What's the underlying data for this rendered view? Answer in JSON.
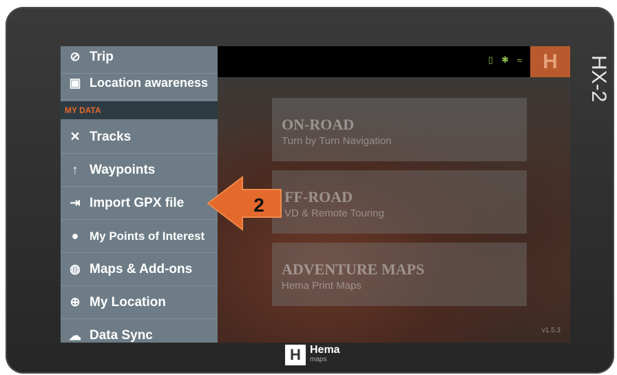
{
  "device": {
    "model": "HX-2",
    "brand_name": "Hema",
    "brand_sub": "maps",
    "logo_letter": "H"
  },
  "drawer": {
    "section_label": "MY DATA",
    "items_top": [
      {
        "label": "Trip",
        "icon": "compass-icon"
      },
      {
        "label": "Location awareness",
        "icon": "map-person-icon"
      }
    ],
    "items": [
      {
        "label": "Tracks",
        "icon": "tracks-icon"
      },
      {
        "label": "Waypoints",
        "icon": "pin-icon"
      },
      {
        "label": "Import GPX file",
        "icon": "import-icon"
      },
      {
        "label": "My Points of Interest",
        "icon": "location-icon"
      },
      {
        "label": "Maps & Add-ons",
        "icon": "globe-icon"
      },
      {
        "label": "My Location",
        "icon": "crosshair-icon"
      },
      {
        "label": "Data Sync",
        "icon": "sync-icon"
      }
    ]
  },
  "status": {
    "battery": "▯",
    "signal": "✱",
    "wifi": "≈",
    "logo": "H"
  },
  "modes": [
    {
      "title": "ON-ROAD",
      "subtitle": "Turn by Turn Navigation"
    },
    {
      "title": "FF-ROAD",
      "subtitle": "VD & Remote Touring"
    },
    {
      "title": "ADVENTURE MAPS",
      "subtitle": "Hema Print Maps"
    }
  ],
  "annotation": {
    "step": "2"
  },
  "version": "v1.5.3",
  "colors": {
    "accent": "#e4692c",
    "drawer": "#6d7c86"
  }
}
